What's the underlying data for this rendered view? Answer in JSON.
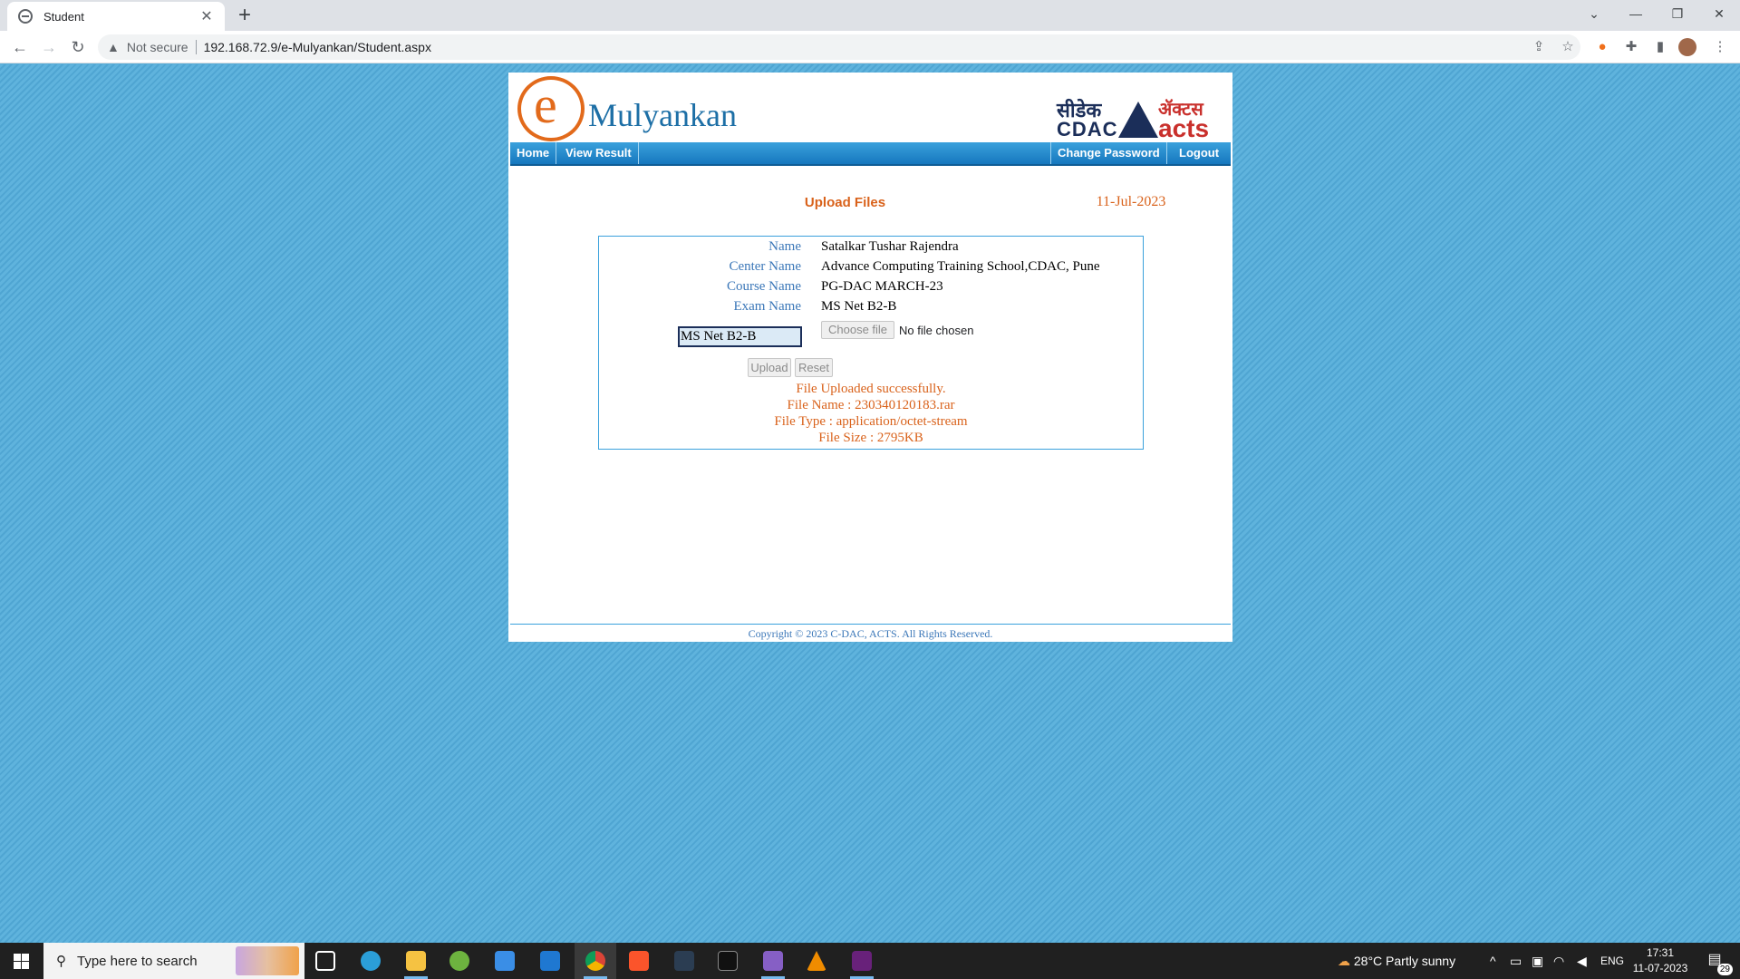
{
  "browser": {
    "tab_title": "Student",
    "tab_close": "✕",
    "new_tab": "+",
    "security_label": "Not secure",
    "url": "192.168.72.9/e-Mulyankan/Student.aspx"
  },
  "site": {
    "logo_letter": "e",
    "logo_word": "Mulyankan",
    "partner_hindi_1": "सीडेक",
    "partner_english_1": "CDAC",
    "partner_hindi_2": "ॲक्टस",
    "partner_english_2": "acts"
  },
  "menu": {
    "home": "Home",
    "view_result": "View Result",
    "change_password": "Change Password",
    "logout": "Logout"
  },
  "page": {
    "heading": "Upload Files",
    "date": "11-Jul-2023"
  },
  "form": {
    "rows": [
      {
        "label": "Name",
        "value": "Satalkar Tushar Rajendra"
      },
      {
        "label": "Center Name",
        "value": "Advance Computing Training School,CDAC, Pune"
      },
      {
        "label": "Course Name",
        "value": "PG-DAC MARCH-23"
      },
      {
        "label": "Exam Name",
        "value": "MS Net B2-B"
      }
    ],
    "exam_select_value": "MS Net B2-B",
    "choose_file_label": "Choose file",
    "no_file_text": "No file chosen",
    "upload_label": "Upload",
    "reset_label": "Reset"
  },
  "result": {
    "status": "File Uploaded successfully.",
    "file_name": "File Name : 230340120183.rar",
    "file_type": "File Type : application/octet-stream",
    "file_size": "File Size : 2795KB"
  },
  "footer": {
    "copyright": "Copyright © 2023 C-DAC, ACTS. All Rights Reserved."
  },
  "taskbar": {
    "search_placeholder": "Type here to search",
    "weather": "28°C  Partly sunny",
    "language": "ENG",
    "time": "17:31",
    "date": "11-07-2023",
    "notification_count": "29"
  },
  "colors": {
    "accent_orange": "#d9621b",
    "menu_blue": "#1677be",
    "label_blue": "#3b77b8"
  }
}
